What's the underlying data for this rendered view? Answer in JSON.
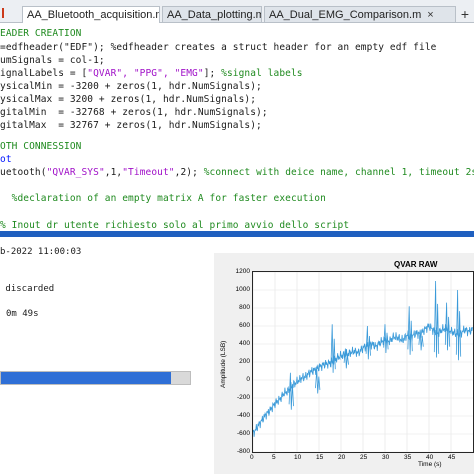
{
  "tabs": [
    {
      "label": "AA_Bluetooth_acquisition.m",
      "close": "×",
      "active": true
    },
    {
      "label": "AA_Data_plotting.m",
      "close": "×",
      "active": false
    },
    {
      "label": "AA_Dual_EMG_Comparison.m",
      "close": "×",
      "active": false
    }
  ],
  "add_tab_label": "+",
  "editor": {
    "l1": "=edfheader(\"EDF\"); %edfheader creates a struct header for an empty edf file",
    "l2": "umSignals = col-1;",
    "l3a": "ignalLabels = [",
    "l3b": "\"QVAR\", \"PPG\", \"EMG\"",
    "l3c": "]; ",
    "l3d": "%signal labels",
    "l4": "ysicalMin = -3200 + zeros(1, hdr.NumSignals);",
    "l5": "ysicalMax = 3200 + zeros(1, hdr.NumSignals);",
    "l6": "gitalMin  = -32768 + zeros(1, hdr.NumSignals);",
    "l7": "gitalMax  = 32767 + zeros(1, hdr.NumSignals);",
    "l8": "OTH CONNESSION",
    "l9": "ot",
    "l10a": "uetooth(",
    "l10b": "\"QVAR_SYS\"",
    "l10c": ",1,",
    "l10d": "\"Timeout\"",
    "l10e": ",2);",
    "l10f": " %connect with deice name, channel 1, timeout 2s",
    "l11": "  %declaration of an empty matrix A for faster execution",
    "l12": "% Inout dr utente richiesto solo al primo avvio dello script",
    "header_line": "EADER CREATION"
  },
  "command_window": {
    "timestamp": "b-2022 11:00:03",
    "discarded": " discarded",
    "elapsed": "0m 49s"
  },
  "progress": {
    "fraction": 0.9
  },
  "chart_data": {
    "type": "line",
    "title": "QVAR RAW",
    "xlabel": "Time (s)",
    "ylabel": "Amplitude (LSB)",
    "xlim": [
      0,
      50
    ],
    "ylim": [
      -800,
      1200
    ],
    "yticks": [
      "1200",
      "1000",
      "800",
      "600",
      "400",
      "200",
      "0",
      "-200",
      "-400",
      "-600",
      "-800"
    ],
    "xticks": [
      "0",
      "5",
      "10",
      "15",
      "20",
      "25",
      "30",
      "35",
      "40",
      "45"
    ],
    "grid": true,
    "series": [
      {
        "color": "#3a9ad9",
        "x": [
          0,
          1,
          2,
          3,
          4,
          5,
          6,
          7,
          8,
          9,
          10,
          11,
          12,
          13,
          14,
          15,
          16,
          17,
          18,
          19,
          20,
          21,
          22,
          23,
          24,
          25,
          26,
          27,
          28,
          29,
          30,
          31,
          32,
          33,
          34,
          35,
          36,
          37,
          38,
          39,
          40,
          41,
          42,
          43,
          44,
          45,
          46,
          47,
          48,
          49,
          50
        ],
        "y": [
          -600,
          -520,
          -450,
          -380,
          -330,
          -260,
          -220,
          -150,
          -120,
          -60,
          -20,
          20,
          40,
          90,
          110,
          140,
          170,
          180,
          200,
          240,
          270,
          280,
          300,
          320,
          300,
          360,
          380,
          400,
          370,
          420,
          450,
          430,
          480,
          470,
          440,
          500,
          480,
          520,
          510,
          560,
          600,
          550,
          520,
          560,
          580,
          540,
          520,
          500,
          560,
          540,
          560
        ]
      }
    ],
    "spikes": [
      {
        "x": 8.5,
        "low": -330,
        "high": 80
      },
      {
        "x": 14.5,
        "low": -150,
        "high": 120
      },
      {
        "x": 18,
        "low": 80,
        "high": 620
      },
      {
        "x": 21,
        "low": 130,
        "high": 350
      },
      {
        "x": 26,
        "low": 230,
        "high": 600
      },
      {
        "x": 30,
        "low": 300,
        "high": 620
      },
      {
        "x": 35.5,
        "low": 280,
        "high": 820
      },
      {
        "x": 38,
        "low": 330,
        "high": 560
      },
      {
        "x": 41.5,
        "low": 250,
        "high": 1100
      },
      {
        "x": 44,
        "low": 330,
        "high": 860
      },
      {
        "x": 46.5,
        "low": 220,
        "high": 1000
      }
    ]
  }
}
